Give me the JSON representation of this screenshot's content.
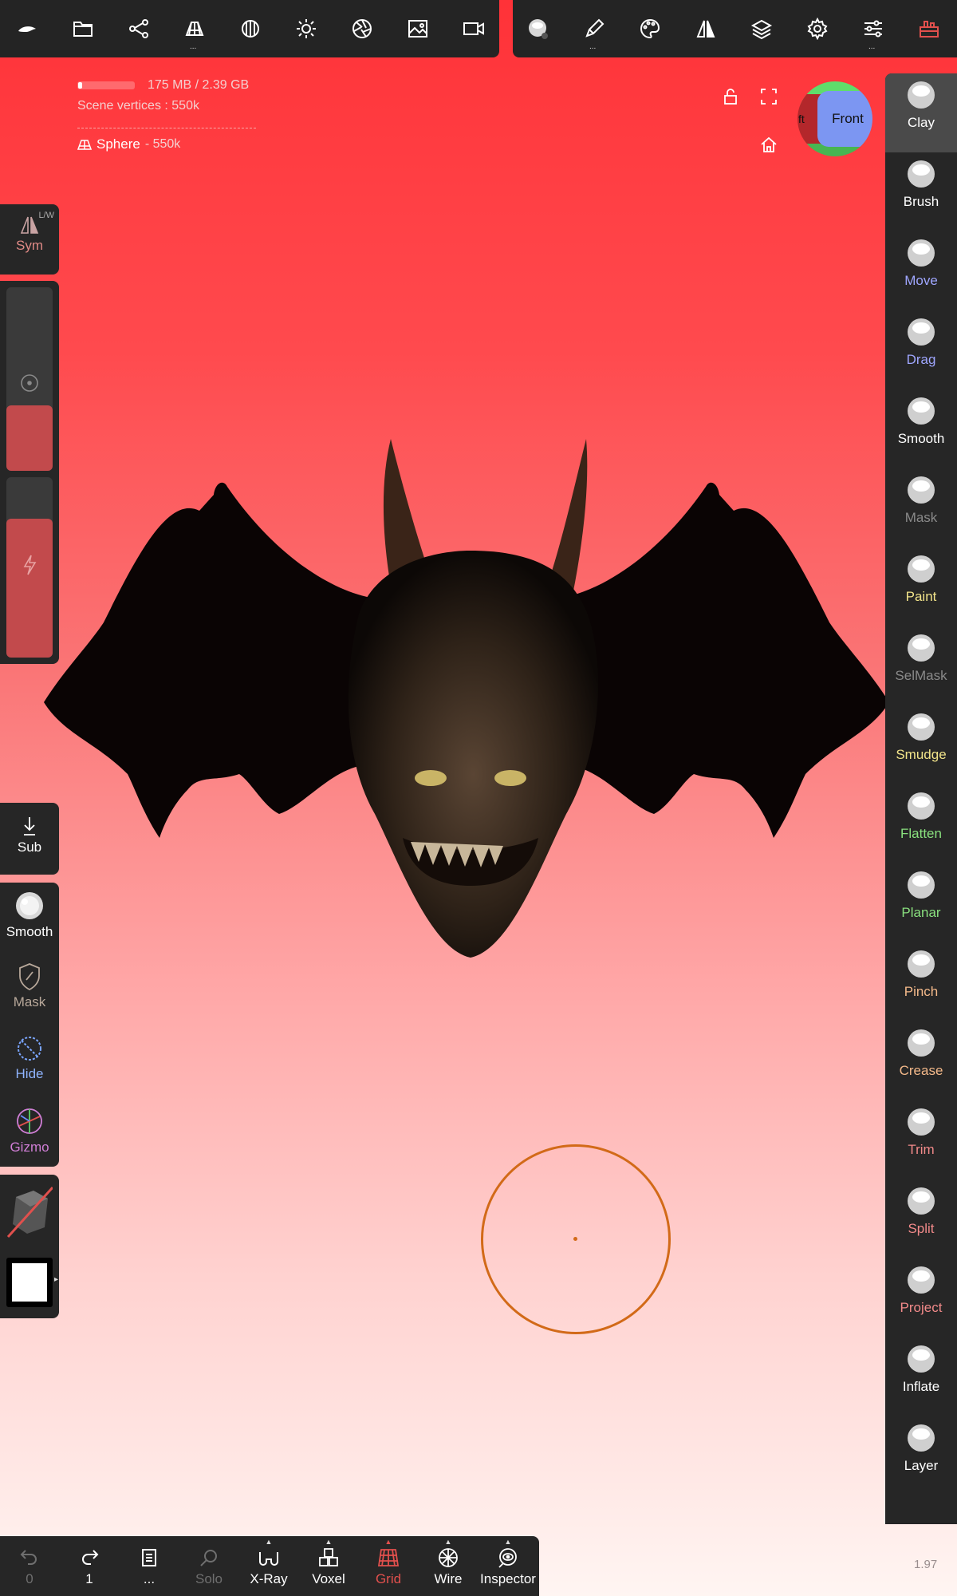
{
  "toolbar_left": {
    "icons": [
      "logo-icon",
      "folder-icon",
      "scene-tree-icon",
      "mesh-icon",
      "material-sphere-icon",
      "sun-light-icon",
      "camera-aperture-icon",
      "image-icon",
      "video-icon"
    ]
  },
  "toolbar_right": {
    "icons": [
      "tool-settings-icon",
      "pen-stroke-icon",
      "palette-icon",
      "symmetry-icon",
      "layers-icon",
      "gear-icon",
      "sliders-icon",
      "toolbox-icon"
    ]
  },
  "info": {
    "memory": "175 MB / 2.39 GB",
    "scene_vertices": "Scene vertices : 550k",
    "mesh_name": "Sphere",
    "mesh_sub": "- 550k"
  },
  "viewcube": {
    "front": "Front",
    "left": "ft"
  },
  "left_panel": {
    "sym": {
      "label": "Sym",
      "badge": "L/W"
    },
    "sub": "Sub",
    "smooth": "Smooth",
    "mask": "Mask",
    "hide": "Hide",
    "gizmo": "Gizmo"
  },
  "right_tools": [
    {
      "label": "Clay",
      "color": "#ffffff"
    },
    {
      "label": "Brush",
      "color": "#ffffff"
    },
    {
      "label": "Move",
      "color": "#9fa6ff"
    },
    {
      "label": "Drag",
      "color": "#9fa6ff"
    },
    {
      "label": "Smooth",
      "color": "#ffffff"
    },
    {
      "label": "Mask",
      "color": "#8a8a8a"
    },
    {
      "label": "Paint",
      "color": "#f2e48a"
    },
    {
      "label": "SelMask",
      "color": "#8a8a8a"
    },
    {
      "label": "Smudge",
      "color": "#f2e48a"
    },
    {
      "label": "Flatten",
      "color": "#89e07e"
    },
    {
      "label": "Planar",
      "color": "#89e07e"
    },
    {
      "label": "Pinch",
      "color": "#f4b98a"
    },
    {
      "label": "Crease",
      "color": "#f4b98a"
    },
    {
      "label": "Trim",
      "color": "#f28a8a"
    },
    {
      "label": "Split",
      "color": "#f28a8a"
    },
    {
      "label": "Project",
      "color": "#f28a8a"
    },
    {
      "label": "Inflate",
      "color": "#ffffff"
    },
    {
      "label": "Layer",
      "color": "#ffffff"
    }
  ],
  "bottom": {
    "undo": "0",
    "redo": "1",
    "more": "...",
    "solo": "Solo",
    "xray": "X-Ray",
    "voxel": "Voxel",
    "grid": "Grid",
    "wire": "Wire",
    "inspector": "Inspector"
  },
  "version": "1.97",
  "colors": {
    "grid_active": "#e2504d",
    "disabled": "#6f6f6f",
    "cursor": "#d26a18"
  }
}
